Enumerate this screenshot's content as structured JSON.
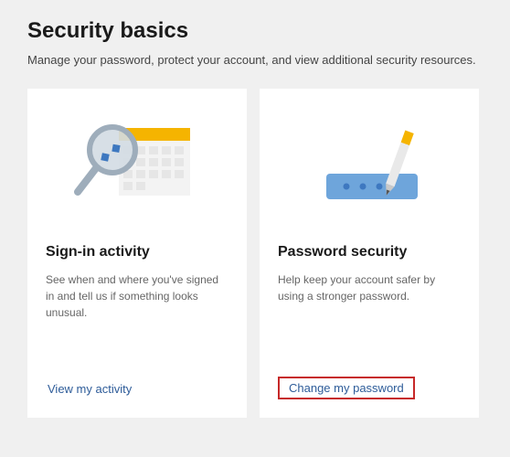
{
  "page": {
    "title": "Security basics",
    "subtitle": "Manage your password, protect your account, and view additional security resources."
  },
  "cards": {
    "signin": {
      "title": "Sign-in activity",
      "description": "See when and where you've signed in and tell us if something looks unusual.",
      "link_label": "View my activity"
    },
    "password": {
      "title": "Password security",
      "description": "Help keep your account safer by using a stronger password.",
      "link_label": "Change my password"
    }
  },
  "colors": {
    "accent_yellow": "#f5b400",
    "accent_blue": "#6ea5db",
    "highlight_red": "#c62828"
  }
}
